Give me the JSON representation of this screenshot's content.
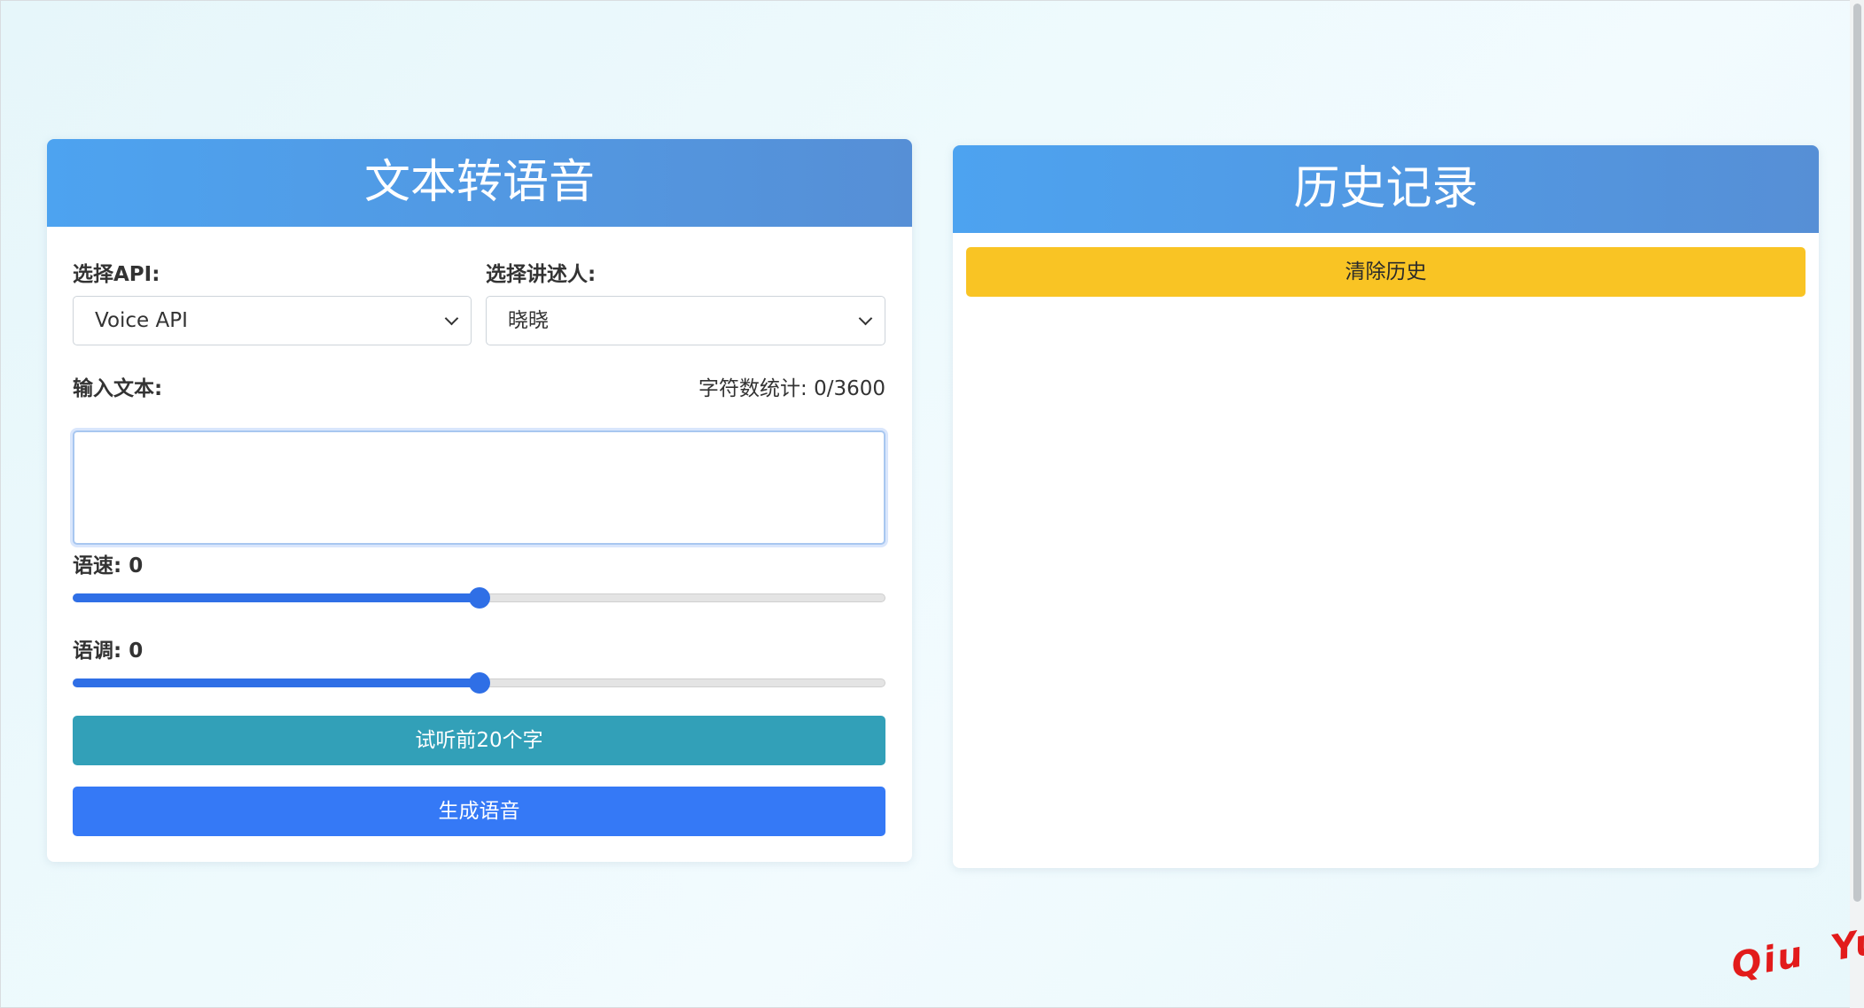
{
  "tts": {
    "title": "文本转语音",
    "api_label": "选择API:",
    "api_selected": "Voice API",
    "speaker_label": "选择讲述人:",
    "speaker_selected": "晓晓",
    "text_label": "输入文本:",
    "char_count_label": "字符数统计:",
    "char_count_value": "0/3600",
    "text_value": "",
    "rate_label": "语速:",
    "rate_value": "0",
    "rate_fraction": 0.5,
    "pitch_label": "语调:",
    "pitch_value": "0",
    "pitch_fraction": 0.5,
    "preview_button": "试听前20个字",
    "generate_button": "生成语音"
  },
  "history": {
    "title": "历史记录",
    "clear_button": "清除历史"
  },
  "watermark": "Qiu  Yue",
  "colors": {
    "header_start": "#4da3f0",
    "header_end": "#568fd6",
    "preview_button": "#32a0b8",
    "generate_button": "#3579f6",
    "clear_button": "#f9c424",
    "slider_accent": "#2f6fe6",
    "watermark": "#e21b1b"
  },
  "icons": {
    "select_arrow": "chevron-down-icon"
  }
}
